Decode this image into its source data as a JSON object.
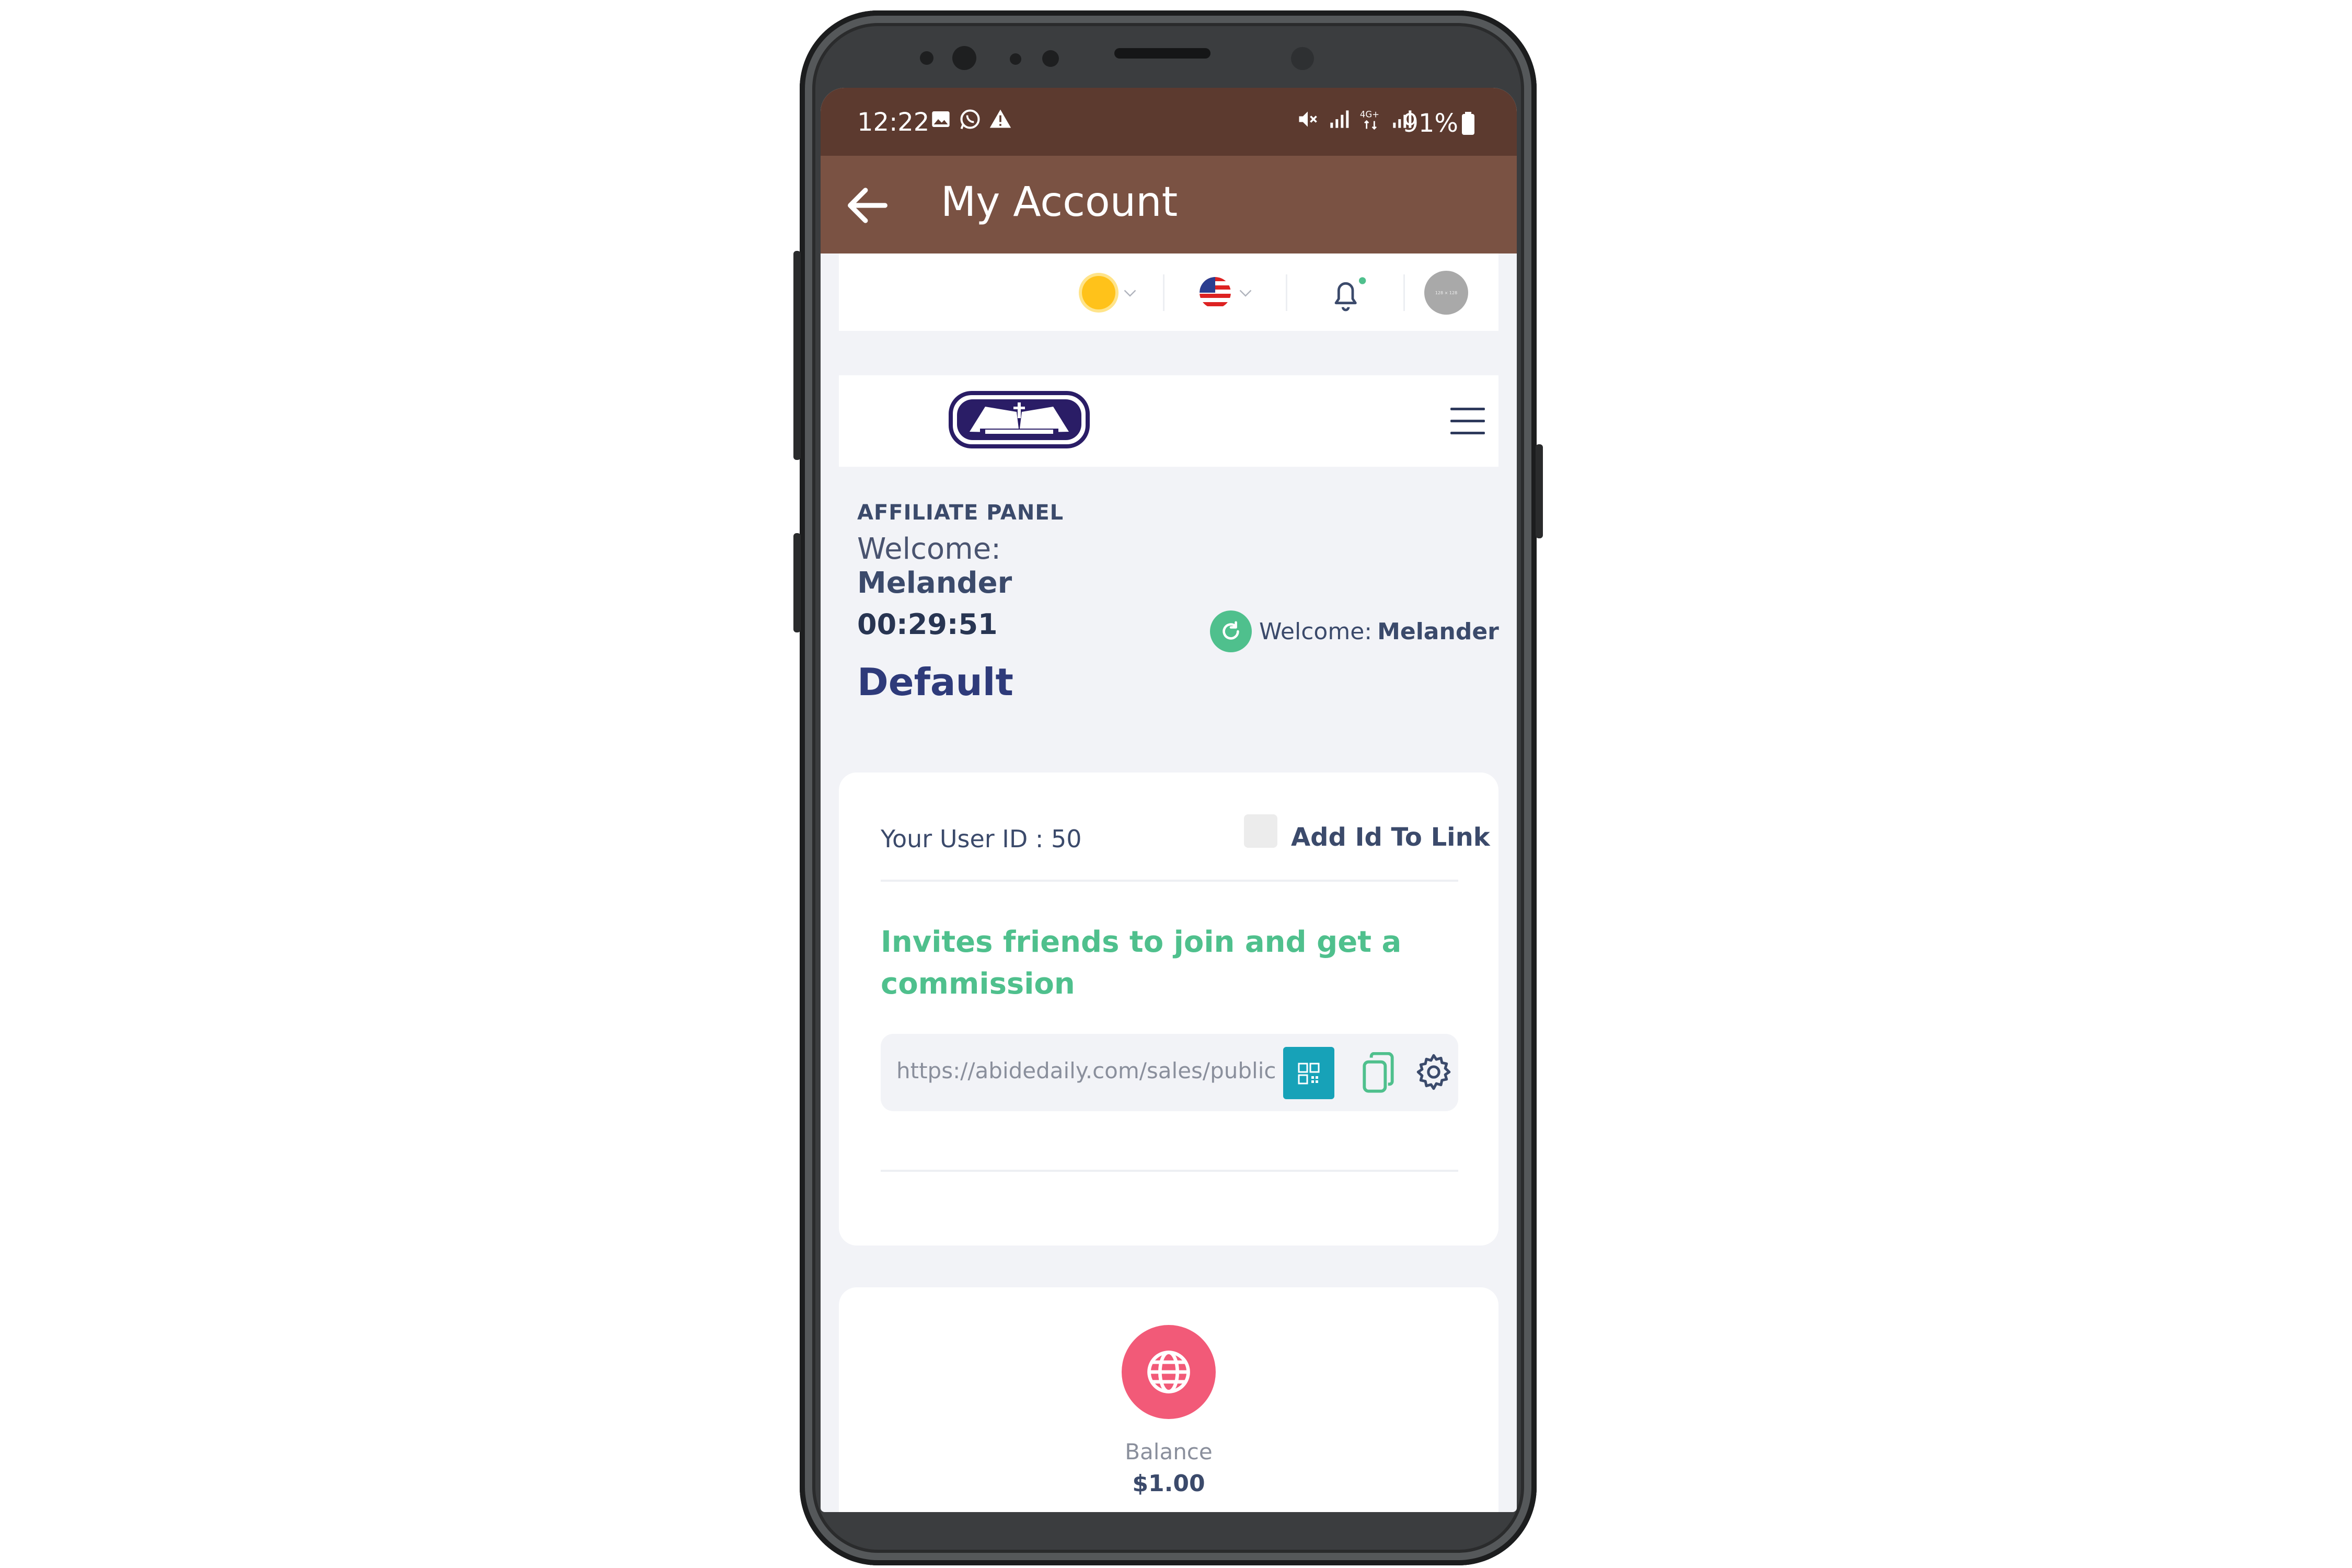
{
  "status_bar": {
    "time": "12:22",
    "battery": "91%"
  },
  "app_bar": {
    "title": "My Account"
  },
  "toolbar": {
    "theme_icon": "sun-icon",
    "language_icon": "us-flag-icon",
    "notification_icon": "bell-icon",
    "avatar_text": "128 × 128"
  },
  "affiliate": {
    "panel_label": "AFFILIATE PANEL",
    "welcome_label": "Welcome:",
    "user_name": "Melander",
    "timer": "00:29:51",
    "plan": "Default",
    "welcome_right_label": "Welcome:",
    "welcome_right_name": "Melander"
  },
  "card": {
    "user_id_text": "Your User ID : 50",
    "add_id_label": "Add Id To Link",
    "invite_text": "Invites friends to join and get a commission",
    "link_url": "https://abidedaily.com/sales/public"
  },
  "balance": {
    "label": "Balance",
    "value": "$1.00"
  },
  "colors": {
    "status_bar": "#5c3a2f",
    "app_bar": "#7a5243",
    "accent_green": "#4fc08d",
    "qr_button": "#17a2b8",
    "balance_icon": "#f25a78"
  }
}
